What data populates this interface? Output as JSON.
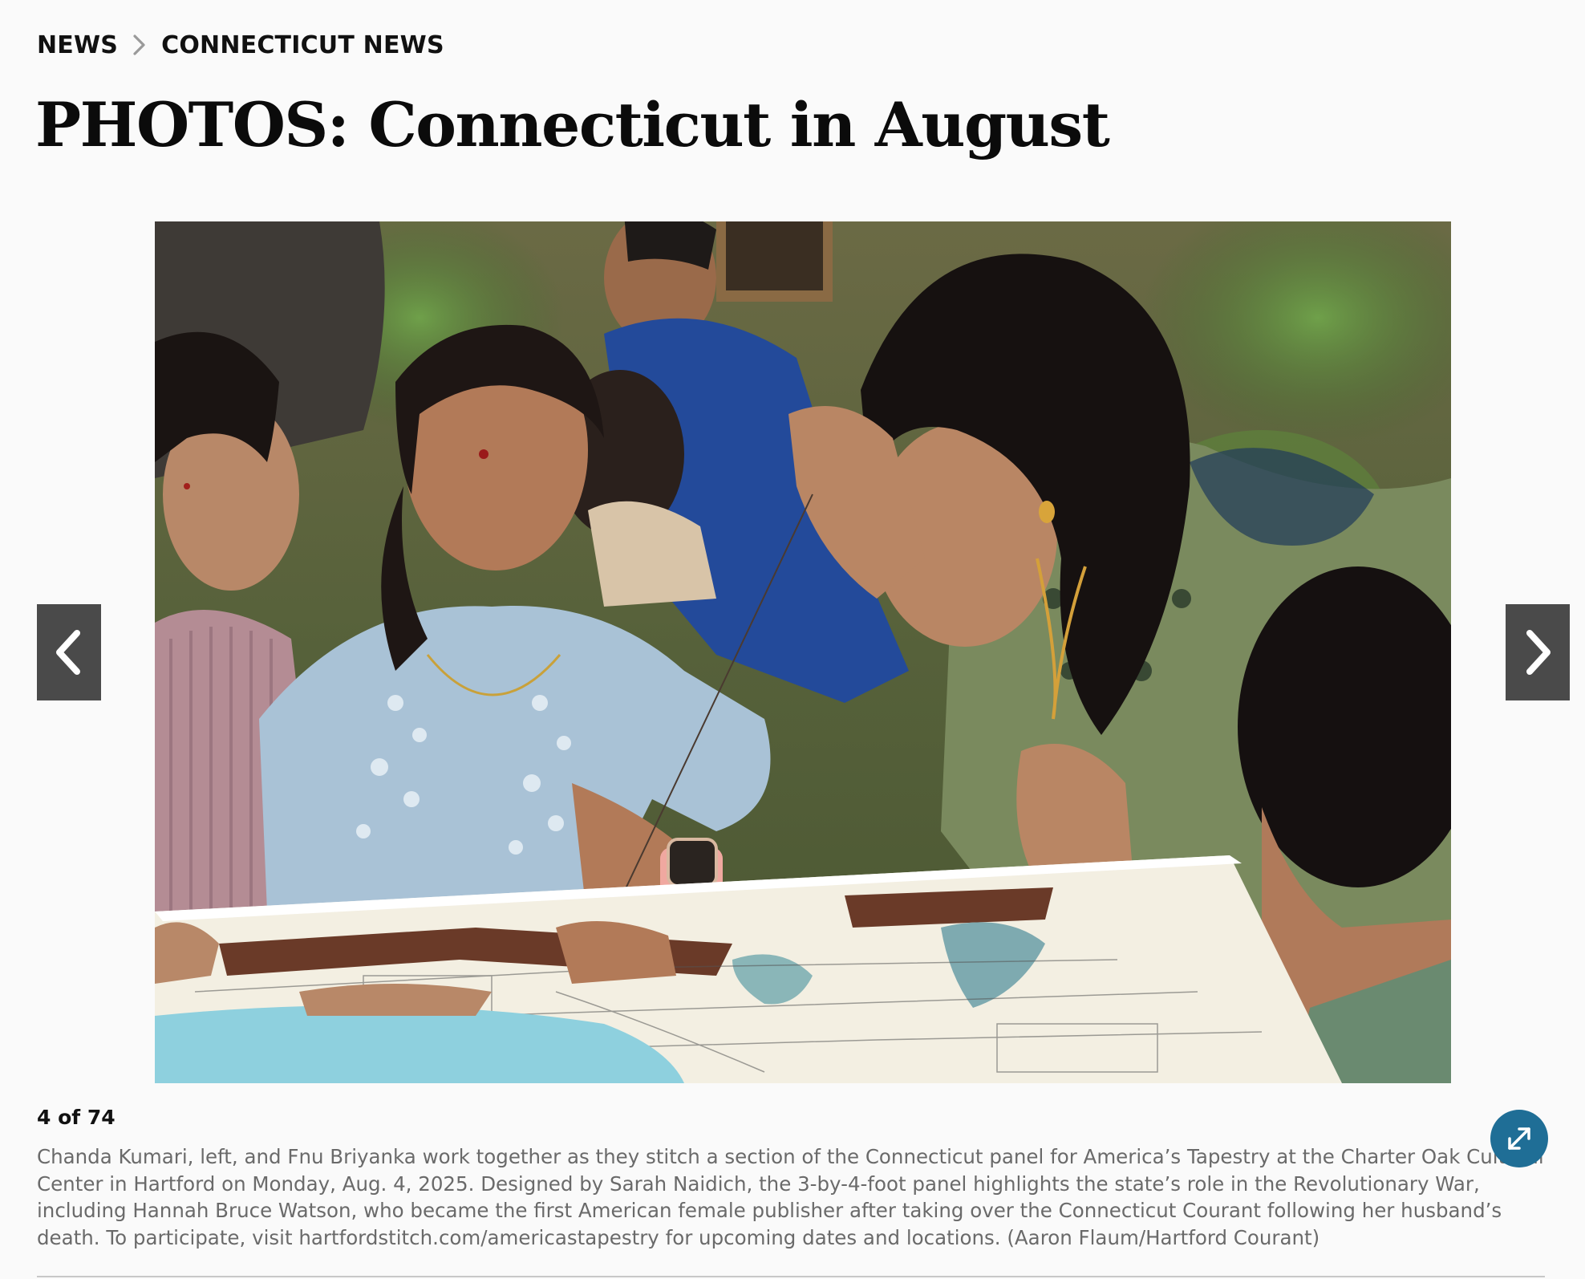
{
  "breadcrumb": {
    "section": "NEWS",
    "subsection": "CONNECTICUT NEWS"
  },
  "article": {
    "title": "PHOTOS: Connecticut in August"
  },
  "gallery": {
    "counter": "4 of 74",
    "caption": "Chanda Kumari, left, and Fnu Briyanka work together as they stitch a section of the Connecticut panel for America’s Tapestry at the Charter Oak Cultural Center in Hartford on Monday, Aug. 4, 2025. Designed by Sarah Naidich, the 3-by-4-foot panel highlights the state’s role in the Revolutionary War, including Hannah Bruce Watson, who became the first American female publisher after taking over the Connecticut Courant following her husband’s death. To participate, visit hartfordstitch.com/americastapestry for upcoming dates and locations. (Aaron Flaum/Hartford Courant)",
    "prev_icon": "chevron-left-icon",
    "next_icon": "chevron-right-icon",
    "expand_icon": "expand-icon"
  },
  "colors": {
    "nav_button": "#4a4a4a",
    "expand_button": "#1f6e96",
    "caption_text": "#6a6a6a",
    "title_text": "#0b0b0b"
  }
}
